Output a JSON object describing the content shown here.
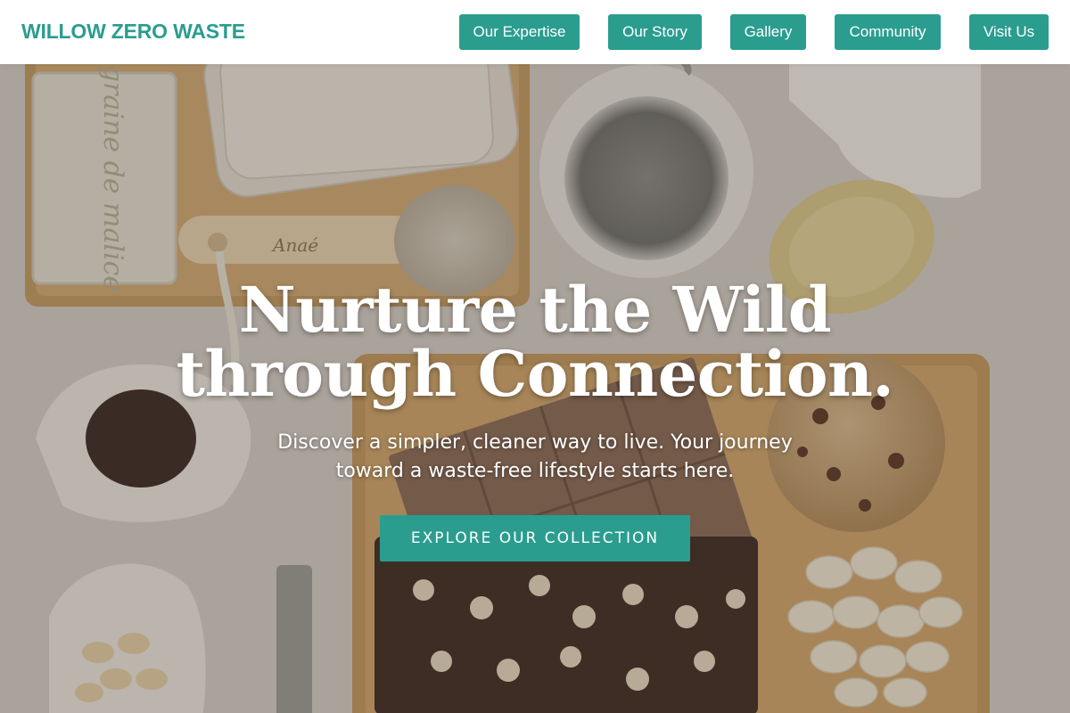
{
  "header": {
    "brand": "WILLOW ZERO WASTE",
    "nav": [
      {
        "label": "Our Expertise"
      },
      {
        "label": "Our Story"
      },
      {
        "label": "Gallery"
      },
      {
        "label": "Community"
      },
      {
        "label": "Visit Us"
      }
    ]
  },
  "hero": {
    "title": "Nurture the Wild through Connection.",
    "subtitle": "Discover a simpler, cleaner way to live. Your journey toward a waste-free lifestyle starts here.",
    "cta_label": "EXPLORE OUR COLLECTION",
    "soap_text": "graine de malice",
    "brush_text": "Anaé"
  },
  "colors": {
    "accent": "#2a9d8f",
    "header_bg": "#ffffff",
    "hero_text": "#ffffff"
  }
}
